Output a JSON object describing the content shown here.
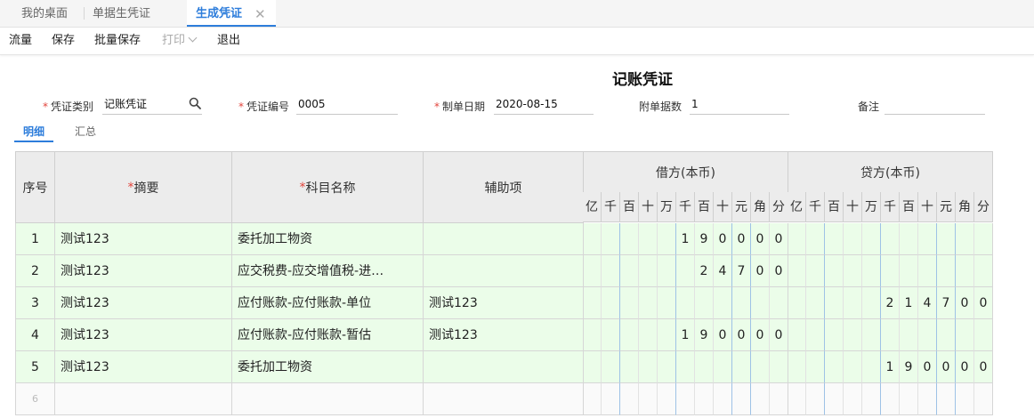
{
  "tabs": [
    {
      "label": "我的桌面"
    },
    {
      "label": "单据生凭证"
    },
    {
      "label": "生成凭证",
      "close": "✕"
    }
  ],
  "toolbar": {
    "flow": "流量",
    "save": "保存",
    "batch_save": "批量保存",
    "print": "打印",
    "exit": "退出"
  },
  "title": "记账凭证",
  "form": {
    "voucher_type_label": "凭证类别",
    "voucher_type_value": "记账凭证",
    "voucher_no_label": "凭证编号",
    "voucher_no_value": "0005",
    "date_label": "制单日期",
    "date_value": "2020-08-15",
    "attach_label": "附单据数",
    "attach_value": "1",
    "remark_label": "备注",
    "remark_value": ""
  },
  "subtabs": {
    "detail": "明细",
    "summary": "汇总"
  },
  "columns": {
    "seq": "序号",
    "summary": "摘要",
    "account": "科目名称",
    "aux": "辅助项",
    "debit": "借方(本币)",
    "credit": "贷方(本币)",
    "units": [
      "亿",
      "千",
      "百",
      "十",
      "万",
      "千",
      "百",
      "十",
      "元",
      "角",
      "分"
    ]
  },
  "rows": [
    {
      "seq": "1",
      "summary": "测试123",
      "account": "委托加工物资",
      "aux": "",
      "debit": "190000",
      "credit": ""
    },
    {
      "seq": "2",
      "summary": "测试123",
      "account": "应交税费-应交增值税-进…",
      "aux": "",
      "debit": "24700",
      "credit": ""
    },
    {
      "seq": "3",
      "summary": "测试123",
      "account": "应付账款-应付账款-单位",
      "aux": "测试123",
      "debit": "",
      "credit": "214700"
    },
    {
      "seq": "4",
      "summary": "测试123",
      "account": "应付账款-应付账款-暂估",
      "aux": "测试123",
      "debit": "190000",
      "credit": ""
    },
    {
      "seq": "5",
      "summary": "测试123",
      "account": "委托加工物资",
      "aux": "",
      "debit": "",
      "credit": "190000"
    },
    {
      "seq": "6",
      "summary": "",
      "account": "",
      "aux": "",
      "debit": "",
      "credit": ""
    }
  ]
}
